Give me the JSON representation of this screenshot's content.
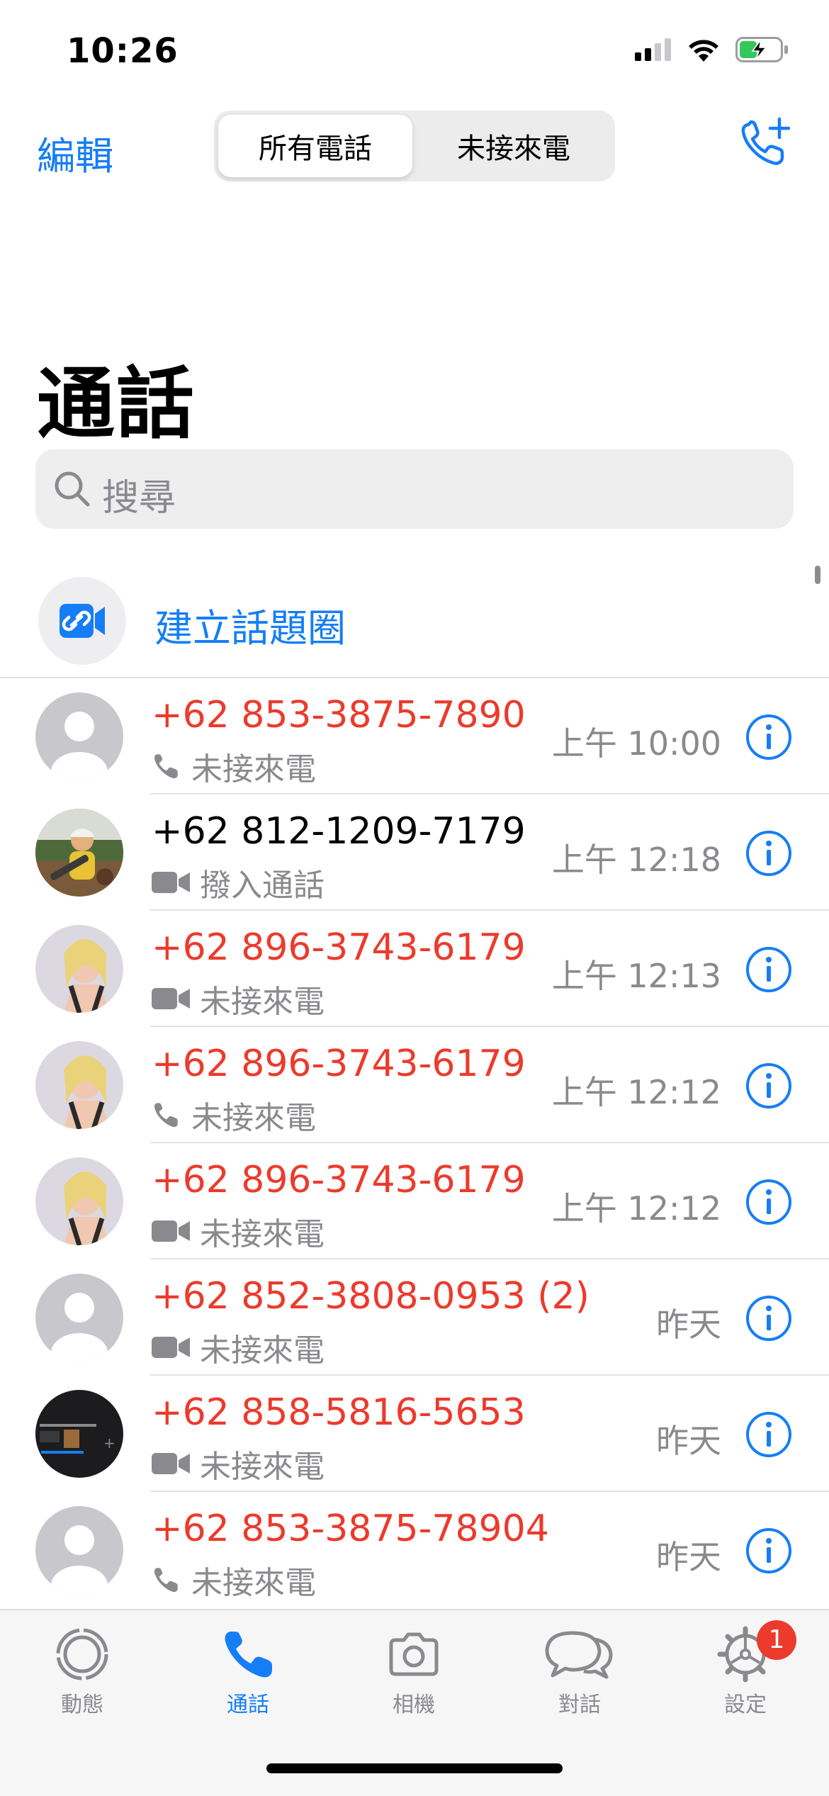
{
  "status_bar": {
    "time": "10:26"
  },
  "nav": {
    "edit": "編輯",
    "segments": [
      "所有電話",
      "未接來電"
    ]
  },
  "title": "通話",
  "search": {
    "placeholder": "搜尋"
  },
  "create_link": {
    "label": "建立話題圈"
  },
  "colors": {
    "accent": "#157ef7",
    "missed": "#ec3a2c",
    "secondary": "#8a8a8e"
  },
  "calls": [
    {
      "number": "+62 853-3875-7890",
      "type_icon": "phone-icon",
      "status": "未接來電",
      "time": "上午 10:00",
      "missed": true,
      "avatar": "placeholder"
    },
    {
      "number": "+62 812-1209-7179",
      "type_icon": "video-icon",
      "status": "撥入通話",
      "time": "上午 12:18",
      "missed": false,
      "avatar": "photo-child"
    },
    {
      "number": "+62 896-3743-6179",
      "type_icon": "video-icon",
      "status": "未接來電",
      "time": "上午 12:13",
      "missed": true,
      "avatar": "photo-woman"
    },
    {
      "number": "+62 896-3743-6179",
      "type_icon": "phone-icon",
      "status": "未接來電",
      "time": "上午 12:12",
      "missed": true,
      "avatar": "photo-woman"
    },
    {
      "number": "+62 896-3743-6179",
      "type_icon": "video-icon",
      "status": "未接來電",
      "time": "上午 12:12",
      "missed": true,
      "avatar": "photo-woman"
    },
    {
      "number": "+62 852-3808-0953  (2)",
      "type_icon": "video-icon",
      "status": "未接來電",
      "time": "昨天",
      "missed": true,
      "avatar": "placeholder"
    },
    {
      "number": "+62 858-5816-5653",
      "type_icon": "video-icon",
      "status": "未接來電",
      "time": "昨天",
      "missed": true,
      "avatar": "photo-screenshot"
    },
    {
      "number": "+62 853-3875-78904",
      "type_icon": "phone-icon",
      "status": "未接來電",
      "time": "昨天",
      "missed": true,
      "avatar": "placeholder"
    }
  ],
  "tabs": [
    {
      "label": "動態",
      "icon": "updates-icon",
      "active": false
    },
    {
      "label": "通話",
      "icon": "phone-icon",
      "active": true
    },
    {
      "label": "相機",
      "icon": "camera-icon",
      "active": false
    },
    {
      "label": "對話",
      "icon": "chats-icon",
      "active": false
    },
    {
      "label": "設定",
      "icon": "settings-icon",
      "active": false,
      "badge": "1"
    }
  ]
}
